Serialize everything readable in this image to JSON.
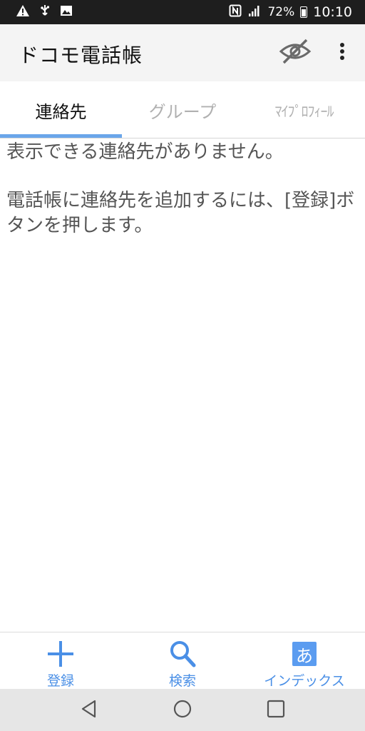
{
  "status_bar": {
    "battery_percent": "72%",
    "time": "10:10",
    "icons": [
      "warning-icon",
      "usb-icon",
      "image-icon",
      "nfc-icon",
      "signal-icon",
      "battery-icon"
    ]
  },
  "app_bar": {
    "title": "ドコモ電話帳",
    "actions": [
      "visibility-off-icon",
      "more-vert-icon"
    ]
  },
  "tabs": [
    {
      "label": "連絡先",
      "active": true
    },
    {
      "label": "グループ",
      "active": false
    },
    {
      "label": "ﾏｲﾌﾟﾛﾌｨｰﾙ",
      "active": false
    }
  ],
  "message": {
    "line1": "表示できる連絡先がありません。",
    "line2": "電話帳に連絡先を追加するには、[登録]ボタンを押します。"
  },
  "bottom_nav": {
    "register_label": "登録",
    "search_label": "検索",
    "index_label": "インデックス",
    "index_icon_char": "あ"
  },
  "colors": {
    "accent": "#4a8fe6",
    "tab_indicator": "#6aa6ea",
    "app_bar_bg": "#f4f4f4",
    "status_bar_bg": "#1e1e1e",
    "nav_bar_bg": "#e6e6e6"
  }
}
